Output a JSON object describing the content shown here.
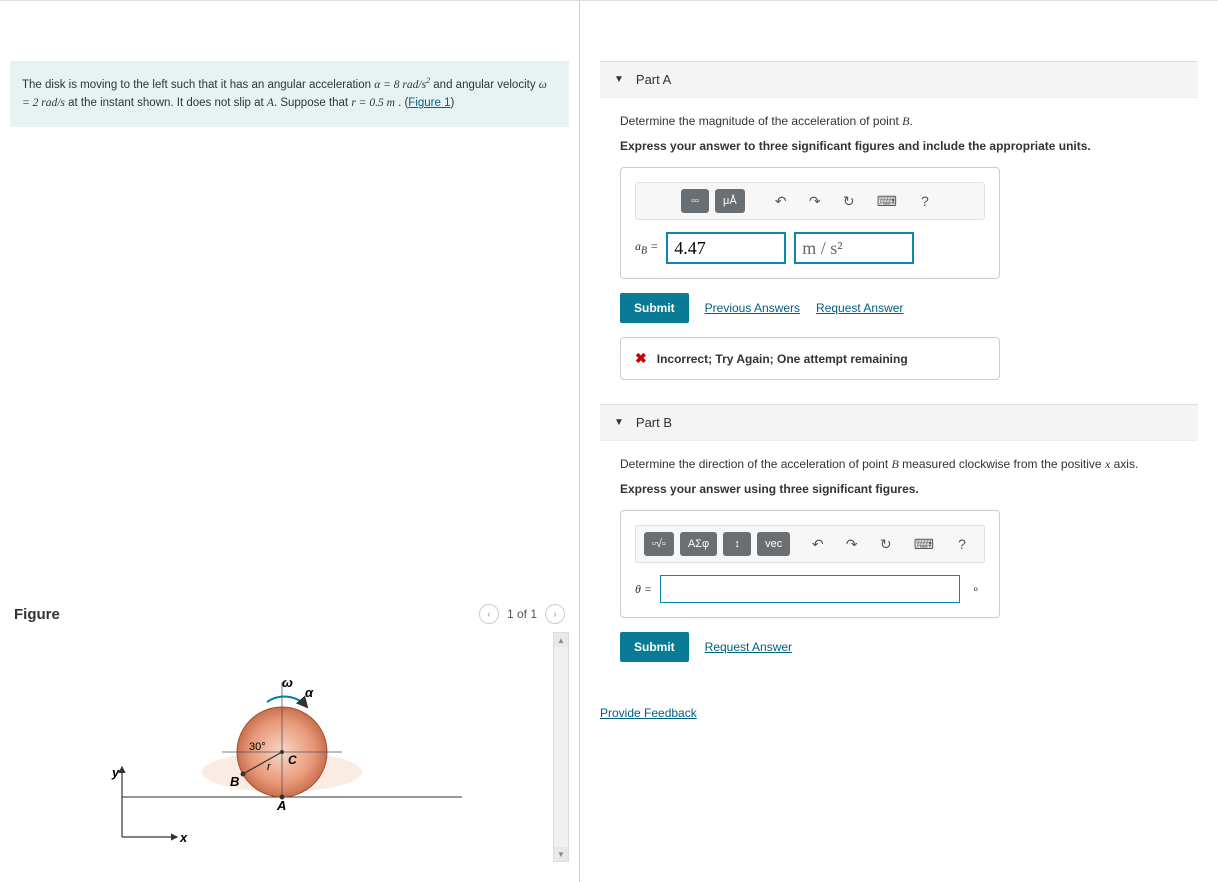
{
  "problem": {
    "text_prefix": "The disk is moving to the left such that it has an angular acceleration ",
    "alpha": "α = 8 rad/s",
    "alpha_sup": "2",
    "text_mid1": " and angular velocity ",
    "omega": "ω = 2 rad/s",
    "text_mid2": " at the instant shown. It does not slip at ",
    "pointA": "A",
    "text_mid3": ". Suppose that ",
    "r_eq": "r = 0.5 m",
    "text_end": " . (",
    "figure_link": "Figure 1",
    "close_paren": ")"
  },
  "figure": {
    "title": "Figure",
    "page_text": "1 of 1",
    "labels": {
      "omega": "ω",
      "alpha": "α",
      "angle": "30°",
      "C": "C",
      "B": "B",
      "A": "A",
      "r": "r",
      "x": "x",
      "y": "y"
    }
  },
  "partA": {
    "title": "Part A",
    "instruction_prefix": "Determine the magnitude of the acceleration of point ",
    "point": "B",
    "instruction_suffix": ".",
    "bold_instruction": "Express your answer to three significant figures and include the appropriate units.",
    "toolbar": {
      "units_fraction": "▫▫",
      "ua": "μÅ",
      "undo": "↶",
      "redo": "↷",
      "reset": "↻",
      "keyboard": "⌨",
      "help": "?"
    },
    "label": "aB =",
    "value": "4.47",
    "units_html": "m / s²",
    "submit": "Submit",
    "previous": "Previous Answers",
    "request": "Request Answer",
    "feedback": "Incorrect; Try Again; One attempt remaining"
  },
  "partB": {
    "title": "Part B",
    "instruction_prefix": "Determine the direction of the acceleration of point ",
    "point": "B",
    "instruction_mid": " measured clockwise from the positive ",
    "axis": "x",
    "instruction_suffix": " axis.",
    "bold_instruction": "Express your answer using three significant figures.",
    "toolbar": {
      "templates": "▫√▫",
      "greek": "ΑΣφ",
      "updown": "↕",
      "vec": "vec",
      "undo": "↶",
      "redo": "↷",
      "reset": "↻",
      "keyboard": "⌨",
      "help": "?"
    },
    "label": "θ =",
    "value": "",
    "unit_suffix": "∘",
    "submit": "Submit",
    "request": "Request Answer"
  },
  "footer": {
    "provide_feedback": "Provide Feedback"
  }
}
